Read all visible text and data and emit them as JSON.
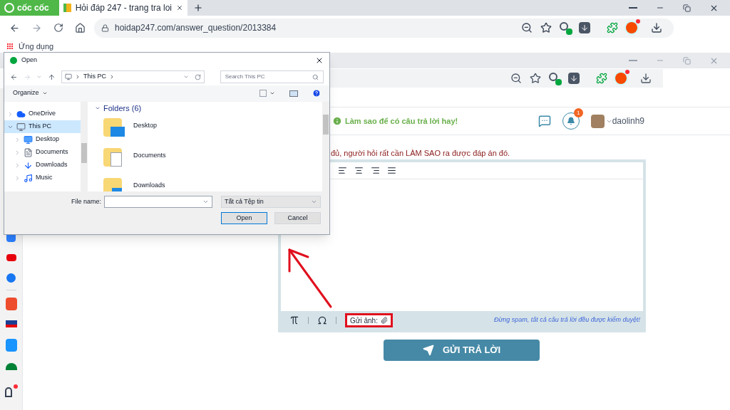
{
  "browser": {
    "brand": "cốc cốc",
    "tabs": [
      {
        "title": "Hỏi đáp 247 - trang tra loi",
        "selected": true
      }
    ],
    "url": "hoidap247.com/answer_question/2013384",
    "bookmarks": [
      "Ứng dụng"
    ]
  },
  "page": {
    "hint": "Làm sao để có câu trả lời hay!",
    "notification_count": "1",
    "username": "daolinh9",
    "note": "đủ, người hỏi rất cần LÀM SAO ra được đáp án đó.",
    "editor": {
      "attach_label": "Gửi ảnh:",
      "attach_highlighted": true,
      "footer_note": "Đừng spam, tất cả câu trả lời đều được kiểm duyệt!"
    },
    "submit": "GỬI TRẢ LỜI"
  },
  "dialog": {
    "title": "Open",
    "breadcrumb": "This PC",
    "search_placeholder": "Search This PC",
    "organize": "Organize",
    "nav": [
      {
        "label": "OneDrive",
        "kind": "cloud",
        "expanded": false,
        "selected": false
      },
      {
        "label": "This PC",
        "kind": "pc",
        "expanded": true,
        "selected": true,
        "children": [
          {
            "label": "Desktop",
            "kind": "desktop",
            "expanded": false,
            "selected": false
          },
          {
            "label": "Documents",
            "kind": "documents",
            "expanded": false,
            "selected": false
          },
          {
            "label": "Downloads",
            "kind": "downloads",
            "expanded": false,
            "selected": false
          },
          {
            "label": "Music",
            "kind": "music",
            "expanded": false,
            "selected": false
          }
        ]
      }
    ],
    "section": "Folders (6)",
    "folders": [
      {
        "label": "Desktop",
        "kind": "desktop"
      },
      {
        "label": "Documents",
        "kind": "documents"
      },
      {
        "label": "Downloads",
        "kind": "downloads"
      }
    ],
    "file_name_label": "File name:",
    "file_type": "Tất cả Tệp tin",
    "buttons": [
      {
        "label": "Open",
        "default": true
      },
      {
        "label": "Cancel",
        "default": false
      }
    ]
  }
}
